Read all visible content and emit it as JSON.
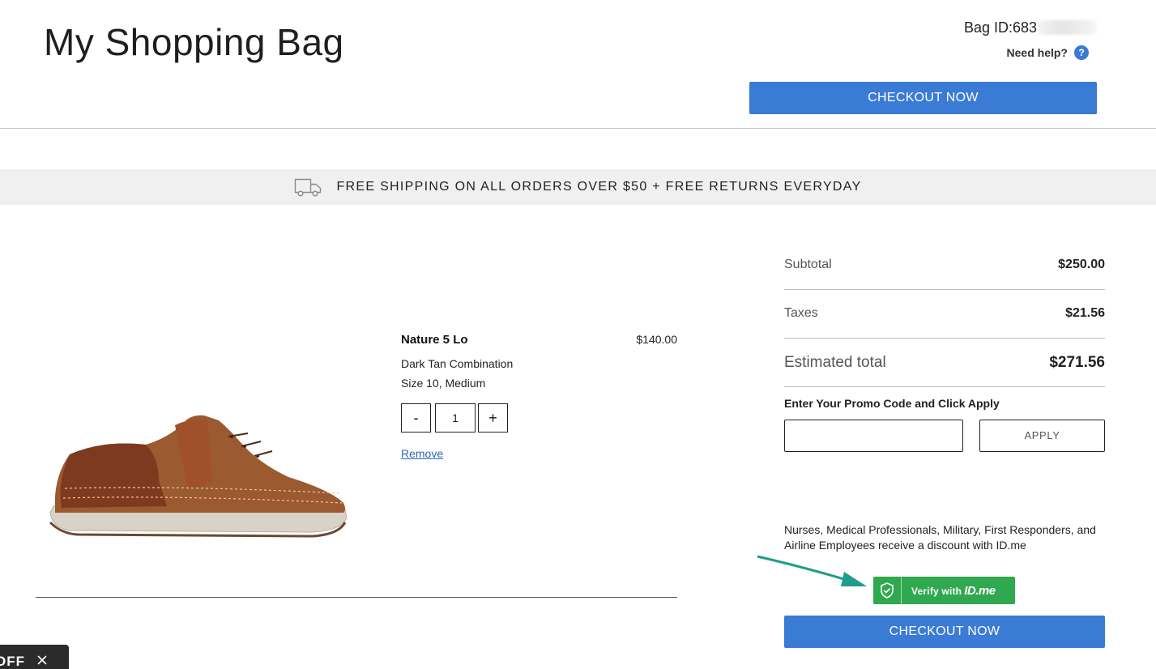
{
  "header": {
    "title": "My Shopping Bag",
    "bag_id_label": "Bag ID:683",
    "help_label": "Need help?",
    "help_icon": "?",
    "checkout_label": "CHECKOUT NOW",
    "accent_color": "#3a7bd5"
  },
  "banner": {
    "icon": "truck-icon",
    "text": "FREE SHIPPING ON ALL ORDERS OVER $50 + FREE RETURNS EVERYDAY"
  },
  "cart": {
    "items": [
      {
        "name": "Nature 5 Lo",
        "price": "$140.00",
        "color": "Dark Tan Combination",
        "size": "Size 10, Medium",
        "quantity": "1",
        "minus_label": "-",
        "plus_label": "+",
        "remove_label": "Remove"
      }
    ]
  },
  "summary": {
    "subtotal_label": "Subtotal",
    "subtotal_value": "$250.00",
    "taxes_label": "Taxes",
    "taxes_value": "$21.56",
    "total_label": "Estimated total",
    "total_value": "$271.56",
    "promo_label": "Enter Your Promo Code and Click Apply",
    "promo_value": "",
    "apply_label": "APPLY",
    "idme_text": "Nurses, Medical Professionals, Military, First Responders, and Airline Employees receive a discount with ID.me",
    "idme_button_label": "Verify with",
    "idme_logo": "ID.me",
    "idme_color": "#2fa84f",
    "checkout_label": "CHECKOUT NOW"
  },
  "offer_tab": {
    "label": "OFF",
    "icon": "close-icon"
  }
}
